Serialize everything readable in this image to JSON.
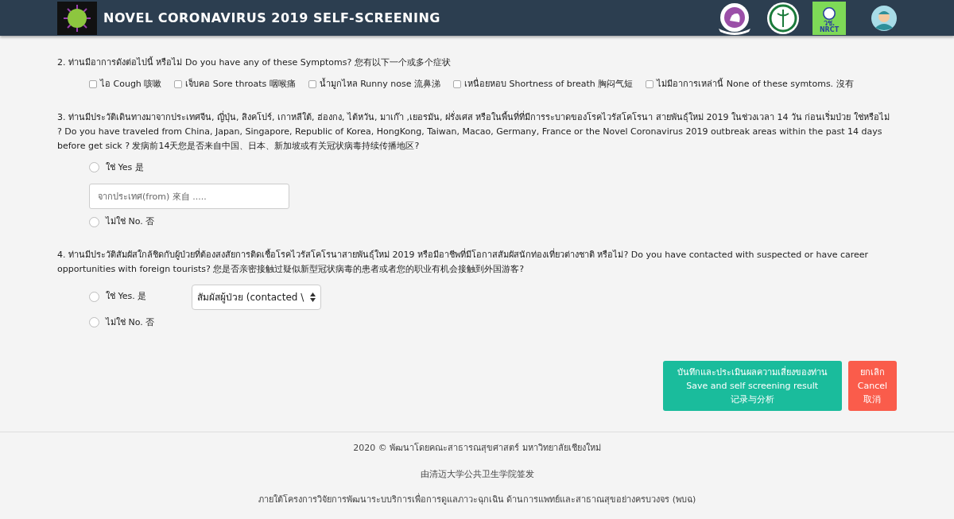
{
  "header": {
    "title": "NOVEL CORONAVIRUS 2019 SELF-SCREENING",
    "logos": [
      {
        "kind": "elephant"
      },
      {
        "kind": "caduceus"
      },
      {
        "kind": "nrct",
        "text": "วช.",
        "subtext": "NRCT"
      },
      {
        "kind": "doctor"
      }
    ]
  },
  "questions": [
    {
      "kind": "checks",
      "text": "2. ท่านมีอาการดังต่อไปนี้ หรือไม่ Do you have any of these Symptoms? 您有以下一个或多个症状",
      "options": [
        {
          "label": "ไอ Cough 咳嗽",
          "checked": false
        },
        {
          "label": "เจ็บคอ Sore throats 咽喉痛",
          "checked": false
        },
        {
          "label": "น้ำมูกไหล Runny nose 流鼻涕",
          "checked": false
        },
        {
          "label": "เหนื่อยหอบ Shortness of breath 胸闷气短",
          "checked": false
        },
        {
          "label": "ไม่มีอาการเหล่านี้ None of these symtoms. 沒有",
          "checked": false
        }
      ]
    },
    {
      "kind": "radios",
      "text": "3. ท่านมีประวัติเดินทางมาจากประเทศจีน, ญี่ปุ่น, สิงคโปร์, เกาหลีใต้, ฮ่องกง, ไต้หวัน, มาเก๊า ,เยอรมัน, ฝรั่งเศส หรือในพื้นที่ที่มีการระบาดของโรคไวรัสโคโรนา สายพันธุ์ใหม่ 2019 ในช่วงเวลา 14 วัน ก่อนเริ่มป่วย ใช่หรือไม่ ? Do you have traveled from China, Japan, Singapore, Republic of Korea, HongKong, Taiwan, Macao, Germany, France or the Novel Coronavirus 2019 outbreak areas within the past 14 days before get sick ? 发病前14天您是否来自中国、日本、新加坡或有关冠状病毒持续传播地区?",
      "options": [
        {
          "label": "ใช่ Yes 是",
          "selected": false,
          "field": {
            "kind": "input",
            "placeholder": "จากประเทศ(from) 來自 ....."
          }
        },
        {
          "label": "ไม่ใช่ No. 否",
          "selected": false
        }
      ]
    },
    {
      "kind": "radios",
      "text": "4. ท่านมีประวัติสัมผัสใกล้ชิดกับผู้ป่วยที่ต้องสงสัยการติดเชื้อโรคไวรัสโคโรนาสายพันธุ์ใหม่ 2019 หรือมีอาชีพที่มีโอกาสสัมผัสนักท่องเที่ยวต่างชาติ หรือไม่? Do you have contacted with suspected or have career opportunities with foreign tourists? 您是否亲密接触过疑似新型冠状病毒的患者或者您的职业有机会接触到外国游客?",
      "options": [
        {
          "label": "ใช่ Yes. 是",
          "selected": false,
          "field": {
            "kind": "select",
            "value": "สัมผัสผู้ป่วย (contacted \\"
          }
        },
        {
          "label": "ไม่ใช่ No. 否",
          "selected": false
        }
      ]
    }
  ],
  "buttons": [
    {
      "kind": "save",
      "lines": [
        "บันทึกและประเมินผลความเสี่ยงของท่าน",
        "Save and self screening result",
        "记录与分析"
      ]
    },
    {
      "kind": "cancel",
      "lines": [
        "ยกเลิก",
        "Cancel",
        "取消"
      ]
    }
  ],
  "footer": [
    "2020 © พัฒนาโดยคณะสาธารณสุขศาสตร์ มหาวิทยาลัยเชียงใหม่",
    "由清迈大学公共卫生学院签发",
    "ภายใต้โครงการวิจัยการพัฒนาระบบริการเพื่อการดูแลภาวะฉุกเฉิน ด้านการแพทย์และสาธาณสุขอย่างครบวงจร (พบฉ)"
  ]
}
